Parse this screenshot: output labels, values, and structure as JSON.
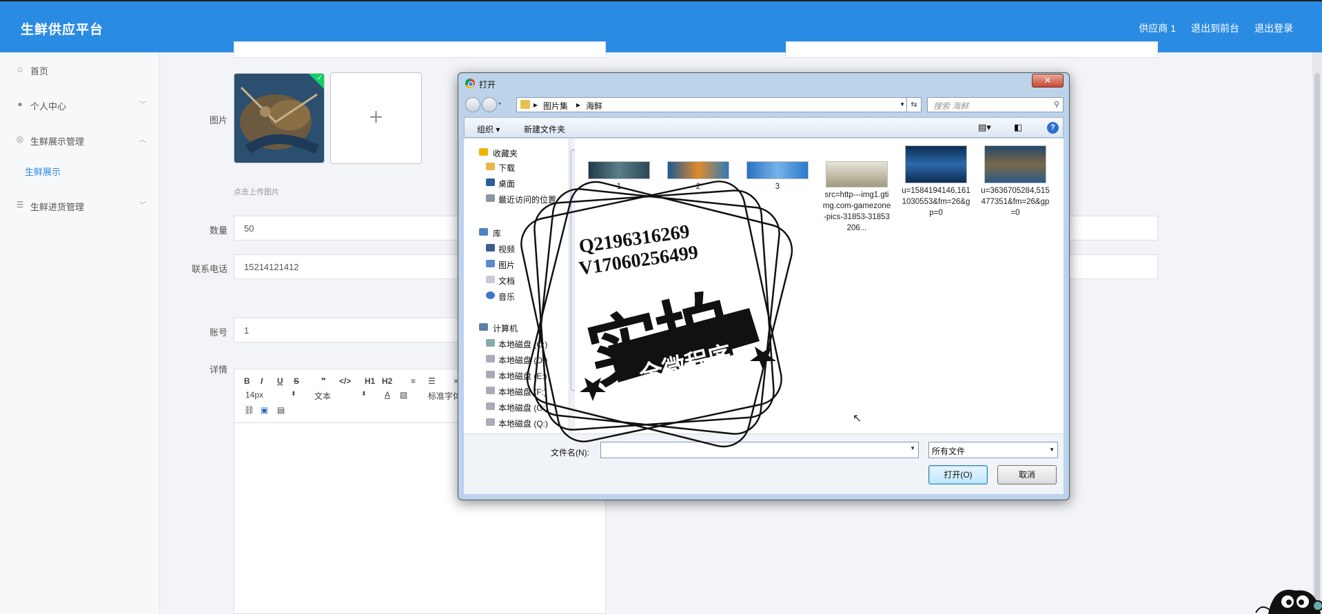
{
  "header": {
    "brand": "生鲜供应平台",
    "links": [
      "供应商 1",
      "退出到前台",
      "退出登录"
    ]
  },
  "sidebar": {
    "items": [
      {
        "label": "首页",
        "icon": "home-icon"
      },
      {
        "label": "个人中心",
        "icon": "user-icon"
      },
      {
        "label": "生鲜展示管理",
        "icon": "palette-icon"
      },
      {
        "label": "生鲜进货管理",
        "icon": "list-icon"
      }
    ],
    "sub_item": "生鲜展示"
  },
  "form": {
    "image_label": "图片",
    "upload_hint": "点击上传图片",
    "upload_plus": "+",
    "quantity_label": "数量",
    "quantity_value": "50",
    "phone_label": "联系电话",
    "phone_value": "15214121412",
    "account_label": "账号",
    "account_value": "1",
    "detail_label": "详情"
  },
  "editor": {
    "buttons": [
      "B",
      "I",
      "U",
      "S",
      "❞",
      "</>",
      "H1",
      "H2"
    ],
    "font_size": "14px",
    "text_type": "文本",
    "font_family": "标准字体",
    "close": "×"
  },
  "dialog": {
    "title": "打开",
    "close": "✕",
    "path": [
      "图片集",
      "海鲜"
    ],
    "search_placeholder": "搜索 海鲜",
    "toolbar": {
      "organize": "组织 ▾",
      "new_folder": "新建文件夹",
      "help": "?"
    },
    "nav": {
      "favorites": "收藏夹",
      "fav_items": [
        "下载",
        "桌面",
        "最近访问的位置"
      ],
      "library": "库",
      "lib_items": [
        "视频",
        "图片",
        "文档",
        "音乐"
      ],
      "computer": "计算机",
      "drives": [
        "本地磁盘 (C:)",
        "本地磁盘 (D:)",
        "本地磁盘 (E:)",
        "本地磁盘 (F:)",
        "本地磁盘 (G:)",
        "本地磁盘 (Q:)"
      ]
    },
    "files": [
      {
        "name": "1",
        "color": "#3a5a6e"
      },
      {
        "name": "2",
        "color": "#2c6fa6"
      },
      {
        "name": "3",
        "color": "#2f7fc9"
      },
      {
        "name": "src=http---img1.gtimg.com-gamezone-pics-31853-31853206...",
        "color": "#a09a80"
      },
      {
        "name": "u=1584194146,1611030553&fm=26&gp=0",
        "color": "#1d4f8c"
      },
      {
        "name": "u=3636705284,515477351&fm=26&gp=0",
        "color": "#3d6e9a"
      }
    ],
    "filename_label": "文件名(N):",
    "filetype": "所有文件",
    "open_button": "打开(O)",
    "cancel_button": "取消"
  },
  "watermark": {
    "line1": "Q2196316269",
    "line2": "V17060256499",
    "big": "实拍",
    "banner": "全微程序"
  }
}
